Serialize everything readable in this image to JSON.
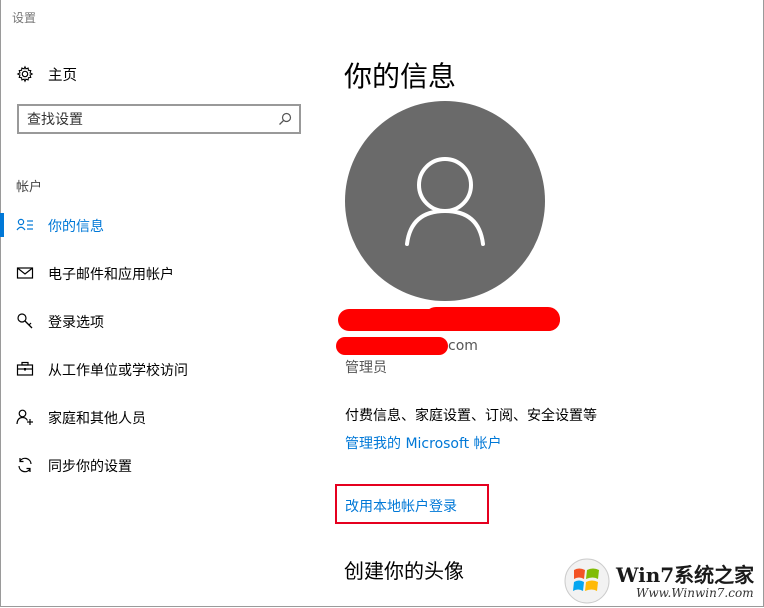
{
  "window": {
    "title": "设置"
  },
  "sidebar": {
    "home_label": "主页",
    "search_placeholder": "查找设置",
    "section_label": "帐户",
    "items": [
      {
        "label": "你的信息",
        "icon": "user-card-icon",
        "active": true
      },
      {
        "label": "电子邮件和应用帐户",
        "icon": "mail-icon",
        "active": false
      },
      {
        "label": "登录选项",
        "icon": "key-icon",
        "active": false
      },
      {
        "label": "从工作单位或学校访问",
        "icon": "briefcase-icon",
        "active": false
      },
      {
        "label": "家庭和其他人员",
        "icon": "person-add-icon",
        "active": false
      },
      {
        "label": "同步你的设置",
        "icon": "sync-icon",
        "active": false
      }
    ]
  },
  "main": {
    "title": "你的信息",
    "email_suffix": "com",
    "role": "管理员",
    "billing_text": "付费信息、家庭设置、订阅、安全设置等",
    "manage_link": "管理我的 Microsoft 帐户",
    "local_account_link": "改用本地帐户登录",
    "create_avatar_title": "创建你的头像"
  },
  "watermark": {
    "text": "Win7系统之家",
    "url": "Www.Winwin7.com"
  },
  "colors": {
    "accent": "#0078d7",
    "avatar_bg": "#6a6a6a",
    "redaction": "#ff0000",
    "highlight_box": "#e5001f"
  }
}
